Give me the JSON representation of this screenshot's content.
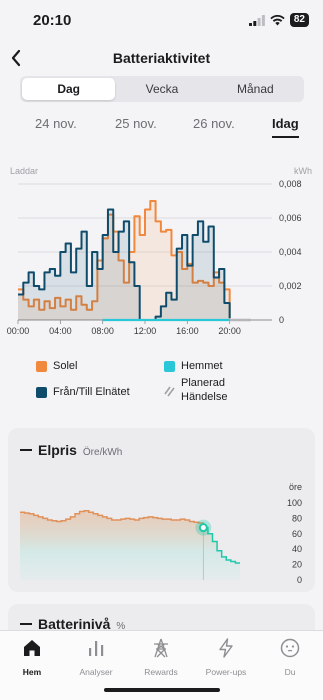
{
  "status": {
    "time": "20:10",
    "battery": "82"
  },
  "header": {
    "title": "Batteriaktivitet"
  },
  "segments": [
    {
      "label": "Dag",
      "active": true
    },
    {
      "label": "Vecka",
      "active": false
    },
    {
      "label": "Månad",
      "active": false
    }
  ],
  "dates": [
    {
      "label": "24 nov.",
      "active": false
    },
    {
      "label": "25 nov.",
      "active": false
    },
    {
      "label": "26 nov.",
      "active": false
    },
    {
      "label": "Idag",
      "active": true
    }
  ],
  "colors": {
    "solar": "#f0883e",
    "grid": "#0f4c6b",
    "home": "#29c7d8",
    "planned": "#b5b5ba",
    "price_line": "#e0915a",
    "price_fill": "#bde8e0"
  },
  "chart_data": [
    {
      "type": "line",
      "top_left_label": "Laddar",
      "unit_label": "kWh",
      "x_ticks": [
        "00:00",
        "04:00",
        "08:00",
        "12:00",
        "16:00",
        "20:00"
      ],
      "y_ticks": [
        "0",
        "0,002",
        "0,004",
        "0,006",
        "0,008"
      ],
      "ylim": [
        0,
        0.008
      ],
      "xlim": [
        0,
        24
      ],
      "series": [
        {
          "name": "Solel",
          "x": [
            0,
            0.5,
            1,
            1.5,
            2,
            2.5,
            3,
            3.5,
            4,
            4.5,
            5,
            5.5,
            6,
            6.5,
            7,
            7.5,
            8,
            8.5,
            9,
            9.5,
            10,
            10.5,
            11,
            11.5,
            12,
            12.5,
            13,
            13.5,
            14,
            14.5,
            15,
            15.5,
            16,
            16.5,
            17,
            17.5,
            18,
            18.5,
            19,
            19.5,
            20
          ],
          "values": [
            0.0018,
            0.0012,
            0.0008,
            0.0012,
            0.0006,
            0.0011,
            0.0007,
            0.0013,
            0.0008,
            0.0012,
            0.0006,
            0.0014,
            0.0009,
            0.0006,
            0.0011,
            0.0035,
            0.0048,
            0.0062,
            0.0052,
            0.0035,
            0.0022,
            0.004,
            0.0061,
            0.005,
            0.0065,
            0.007,
            0.0058,
            0.0052,
            0.0053,
            0.0038,
            0.004,
            0.003,
            0.0033,
            0.0022,
            0.0023,
            0.0022,
            0.002,
            0.0028,
            0.0022,
            0.0018,
            0.0001
          ]
        },
        {
          "name": "Från/Till Elnätet",
          "x": [
            0,
            0.5,
            1,
            1.5,
            2,
            2.5,
            3,
            3.5,
            4,
            4.5,
            5,
            5.5,
            6,
            6.5,
            7,
            7.5,
            8,
            8.5,
            9,
            9.5,
            10,
            10.5,
            11,
            11.5,
            12,
            12.5,
            13,
            13.5,
            14,
            14.5,
            15,
            15.5,
            16,
            16.5,
            17,
            17.5,
            18,
            18.5,
            19,
            19.5,
            20
          ],
          "values": [
            0.0015,
            0.0022,
            0.0028,
            0.002,
            0.0018,
            0.0028,
            0.003,
            0.0026,
            0.004,
            0.0045,
            0.0028,
            0.0042,
            0.0052,
            0.002,
            0.004,
            0.003,
            0.005,
            0.0065,
            0.004,
            0.0052,
            0.0058,
            0.0034,
            0.002,
            0.0,
            0.0,
            0.0,
            0.0002,
            0.0008,
            0.0016,
            0.0012,
            0.0042,
            0.005,
            0.0032,
            0.005,
            0.0058,
            0.0046,
            0.0055,
            0.0025,
            0.003,
            0.001,
            0.0001
          ]
        },
        {
          "name": "Hemmet",
          "x": [
            8,
            20
          ],
          "values": [
            0,
            0
          ]
        }
      ],
      "planned_event": {
        "name": "Planerad Händelse",
        "x": [
          20,
          22
        ],
        "value": 0
      }
    },
    {
      "type": "line",
      "title": "Elpris",
      "unit_label": "Öre/kWh",
      "axis_unit": "öre",
      "y_ticks": [
        "0",
        "20",
        "40",
        "60",
        "80",
        "100"
      ],
      "ylim": [
        0,
        100
      ],
      "x": [
        0,
        1,
        2,
        3,
        4,
        5,
        6,
        7,
        8,
        9,
        10,
        11,
        12,
        13,
        14,
        15,
        16,
        17,
        18,
        19,
        20,
        21,
        22,
        23,
        24,
        25,
        26,
        27,
        28,
        29,
        30,
        31,
        32,
        33,
        34,
        35,
        36,
        37,
        38,
        39,
        40,
        41,
        42,
        43,
        44,
        45,
        46,
        47,
        48
      ],
      "values": [
        88,
        87,
        86,
        84,
        82,
        80,
        78,
        77,
        76,
        77,
        79,
        82,
        86,
        89,
        90,
        88,
        86,
        84,
        82,
        80,
        78,
        78,
        79,
        80,
        79,
        78,
        80,
        81,
        82,
        81,
        80,
        79,
        79,
        78,
        78,
        79,
        78,
        76,
        75,
        74,
        68,
        60,
        50,
        38,
        30,
        26,
        24,
        22,
        22
      ],
      "marker_index": 40
    }
  ],
  "legend": [
    {
      "label": "Solel",
      "key": "solar"
    },
    {
      "label": "Hemmet",
      "key": "home"
    },
    {
      "label": "Från/Till Elnätet",
      "key": "grid"
    },
    {
      "label": "Planerad Händelse",
      "key": "planned"
    }
  ],
  "battery_card": {
    "title": "Batterinivå",
    "unit": "%"
  },
  "tabs": [
    {
      "label": "Hem",
      "icon": "home-icon",
      "active": true
    },
    {
      "label": "Analyser",
      "icon": "bar-chart-icon",
      "active": false
    },
    {
      "label": "Rewards",
      "icon": "tower-icon",
      "active": false
    },
    {
      "label": "Power-ups",
      "icon": "bolt-icon",
      "active": false
    },
    {
      "label": "Du",
      "icon": "face-icon",
      "active": false
    }
  ]
}
